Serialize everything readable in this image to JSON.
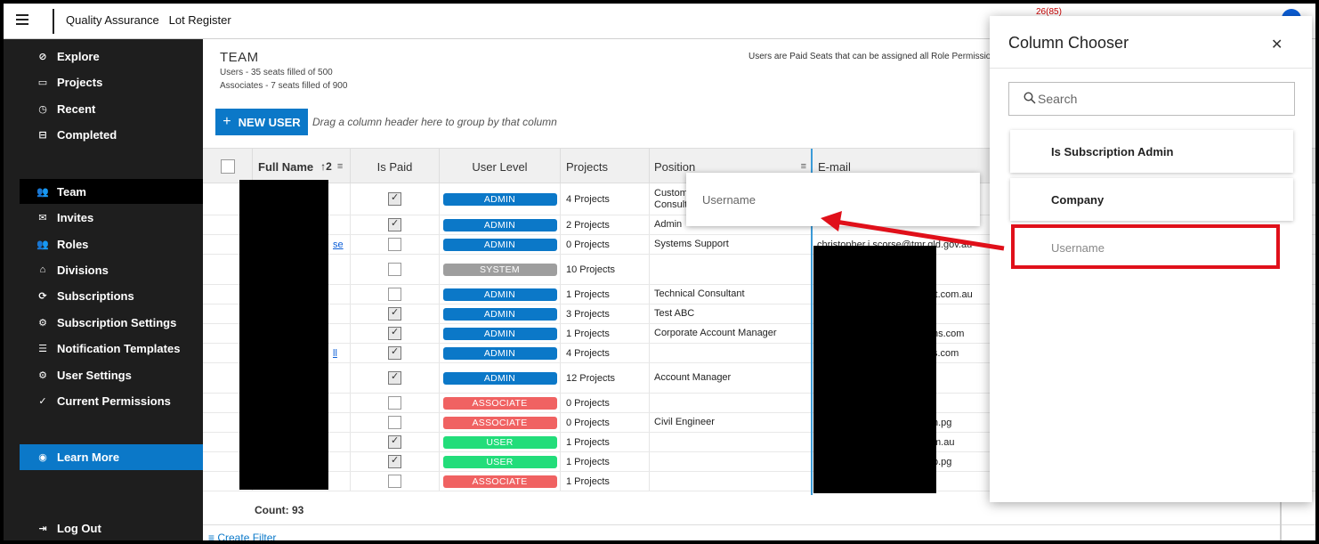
{
  "topbar": {
    "title": "Quality Assurance   Lot Register",
    "right_peek": "26(85)"
  },
  "sidebar": {
    "items": [
      {
        "label": "Explore",
        "icon": "compass-icon",
        "glyph": "⊘"
      },
      {
        "label": "Projects",
        "icon": "folder-icon",
        "glyph": "▭"
      },
      {
        "label": "Recent",
        "icon": "clock-icon",
        "glyph": "◷"
      },
      {
        "label": "Completed",
        "icon": "archive-icon",
        "glyph": "⊟"
      },
      {
        "label": "Team",
        "icon": "people-icon",
        "glyph": "👥",
        "active": true
      },
      {
        "label": "Invites",
        "icon": "mail-icon",
        "glyph": "✉"
      },
      {
        "label": "Roles",
        "icon": "people-icon",
        "glyph": "👥"
      },
      {
        "label": "Divisions",
        "icon": "home-icon",
        "glyph": "⌂"
      },
      {
        "label": "Subscriptions",
        "icon": "sync-icon",
        "glyph": "⟳"
      },
      {
        "label": "Subscription Settings",
        "icon": "gear-icon",
        "glyph": "⚙"
      },
      {
        "label": "Notification Templates",
        "icon": "list-icon",
        "glyph": "☰"
      },
      {
        "label": "User Settings",
        "icon": "gear-icon",
        "glyph": "⚙"
      },
      {
        "label": "Current Permissions",
        "icon": "check-icon",
        "glyph": "✓"
      }
    ],
    "learn_more": "Learn More",
    "logout": "Log Out"
  },
  "team": {
    "heading": "TEAM",
    "users_line": "Users - 35 seats filled of 500",
    "associates_line": "Associates - 7 seats filled of 900",
    "paid_note": "Users are Paid Seats that can be assigned all Role Permissions"
  },
  "toolbar": {
    "new_user": "NEW USER",
    "group_hint": "Drag a column header here to group by that column"
  },
  "grid": {
    "headers": {
      "full_name": "Full Name",
      "sort_order": "2",
      "is_paid": "Is Paid",
      "user_level": "User Level",
      "projects": "Projects",
      "position": "Position",
      "email": "E-mail"
    },
    "rows": [
      {
        "paid": true,
        "level": "ADMIN",
        "projects": "4 Projects",
        "position": "Custom\nConsulta",
        "email": "",
        "name_frag": ""
      },
      {
        "paid": true,
        "level": "ADMIN",
        "projects": "2 Projects",
        "position": "Admin",
        "email": "",
        "name_frag": ""
      },
      {
        "paid": false,
        "level": "ADMIN",
        "projects": "0 Projects",
        "position": "Systems Support",
        "email": "christopher.j.scorse@tmr.qld.gov.au",
        "name_frag": "se"
      },
      {
        "paid": false,
        "level": "SYSTEM",
        "projects": "10 Projects",
        "position": "",
        "email": "",
        "name_frag": ""
      },
      {
        "paid": false,
        "level": "ADMIN",
        "projects": "1 Projects",
        "position": "Technical Consultant",
        "email": "int.com.au",
        "name_frag": ""
      },
      {
        "paid": true,
        "level": "ADMIN",
        "projects": "3 Projects",
        "position": "Test ABC",
        "email": "",
        "name_frag": ""
      },
      {
        "paid": true,
        "level": "ADMIN",
        "projects": "1 Projects",
        "position": "Corporate Account Manager",
        "email": "ns.com",
        "name_frag": ""
      },
      {
        "paid": true,
        "level": "ADMIN",
        "projects": "4 Projects",
        "position": "",
        "email": "s.com",
        "name_frag": "ll"
      },
      {
        "paid": true,
        "level": "ADMIN",
        "projects": "12 Projects",
        "position": "Account Manager",
        "email": "",
        "name_frag": ""
      },
      {
        "paid": false,
        "level": "ASSOCIATE",
        "projects": "0 Projects",
        "position": "",
        "email": "",
        "name_frag": ""
      },
      {
        "paid": false,
        "level": "ASSOCIATE",
        "projects": "0 Projects",
        "position": "Civil Engineer",
        "email": "n.pg",
        "name_frag": ""
      },
      {
        "paid": true,
        "level": "USER",
        "projects": "1 Projects",
        "position": "",
        "email": "m.au",
        "name_frag": ""
      },
      {
        "paid": true,
        "level": "USER",
        "projects": "1 Projects",
        "position": "",
        "email": "p.pg",
        "name_frag": ""
      },
      {
        "paid": false,
        "level": "ASSOCIATE",
        "projects": "1 Projects",
        "position": "",
        "email": "",
        "name_frag": ""
      }
    ],
    "count": "Count: 93",
    "create_filter": "Create Filter"
  },
  "level_colors": {
    "ADMIN": "#0b78c8",
    "SYSTEM": "#9e9e9e",
    "ASSOCIATE": "#f06262",
    "USER": "#22dd7a"
  },
  "drag_ghost": {
    "label": "Username"
  },
  "column_chooser": {
    "title": "Column Chooser",
    "search_placeholder": "Search",
    "items": [
      "Is Subscription Admin",
      "Company",
      "Username"
    ]
  },
  "annotation": {
    "highlight_color": "#e0101a"
  }
}
